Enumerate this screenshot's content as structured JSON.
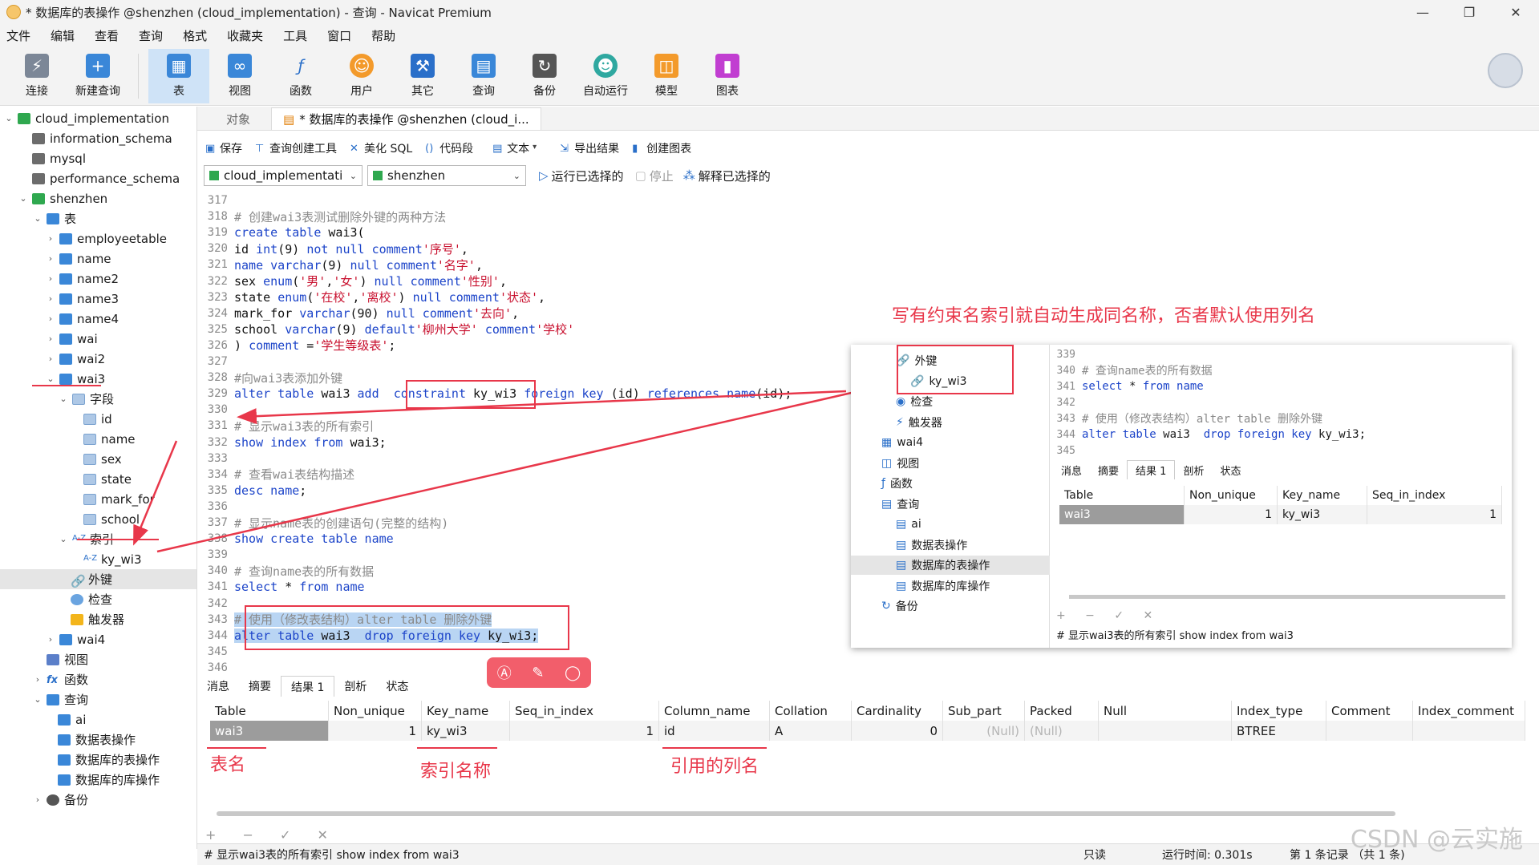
{
  "window": {
    "title": "* 数据库的表操作 @shenzhen (cloud_implementation) - 查询 - Navicat Premium",
    "controls": [
      "—",
      "❐",
      "✕"
    ]
  },
  "menu": [
    "文件",
    "编辑",
    "查看",
    "查询",
    "格式",
    "收藏夹",
    "工具",
    "窗口",
    "帮助"
  ],
  "toolbar": {
    "connect": "连接",
    "new_query": "新建查询",
    "table": "表",
    "view": "视图",
    "function": "函数",
    "user": "用户",
    "other": "其它",
    "query": "查询",
    "backup": "备份",
    "auto_run": "自动运行",
    "model": "模型",
    "chart": "图表"
  },
  "tree": {
    "root": "cloud_implementation",
    "dbs": [
      "information_schema",
      "mysql",
      "performance_schema",
      "shenzhen"
    ],
    "tables_label": "表",
    "tables": [
      "employeetable",
      "name",
      "name2",
      "name3",
      "name4",
      "wai",
      "wai2",
      "wai3"
    ],
    "fields_label": "字段",
    "fields": [
      "id",
      "name",
      "sex",
      "state",
      "mark_for",
      "school"
    ],
    "index_label": "索引",
    "index_item": "ky_wi3",
    "fk_label": "外键",
    "check_label": "检查",
    "trigger_label": "触发器",
    "wai4": "wai4",
    "views_label": "视图",
    "func_label": "函数",
    "query_label": "查询",
    "queries": [
      "ai",
      "数据表操作",
      "数据库的表操作",
      "数据库的库操作"
    ],
    "backup_label": "备份"
  },
  "tabs": {
    "objects": "对象",
    "query_tab": "* 数据库的表操作 @shenzhen (cloud_i..."
  },
  "query_toolbar": {
    "save": "保存",
    "builder": "查询创建工具",
    "beautify": "美化 SQL",
    "snippet": "代码段",
    "text": "文本",
    "export": "导出结果",
    "create_chart": "创建图表"
  },
  "selectors": {
    "connection": "cloud_implementati",
    "database": "shenzhen",
    "run_selected": "运行已选择的",
    "stop": "停止",
    "explain": "解释已选择的"
  },
  "code_lines": [
    {
      "n": "317",
      "html": ""
    },
    {
      "n": "318",
      "html": "<span class='cm'># 创建wai3表测试删除外键的两种方法</span>"
    },
    {
      "n": "319",
      "html": "<span class='kw'>create table</span> wai3("
    },
    {
      "n": "320",
      "html": "id <span class='kw'>int</span>(9) <span class='kw'>not null comment</span><span class='str'>'序号'</span>,"
    },
    {
      "n": "321",
      "html": "<span class='kw'>name varchar</span>(9) <span class='kw'>null comment</span><span class='str'>'名字'</span>,"
    },
    {
      "n": "322",
      "html": "sex <span class='kw'>enum</span>(<span class='str'>'男'</span>,<span class='str'>'女'</span>) <span class='kw'>null comment</span><span class='str'>'性别'</span>,"
    },
    {
      "n": "323",
      "html": "state <span class='kw'>enum</span>(<span class='str'>'在校'</span>,<span class='str'>'离校'</span>) <span class='kw'>null comment</span><span class='str'>'状态'</span>,"
    },
    {
      "n": "324",
      "html": "mark_for <span class='kw'>varchar</span>(90) <span class='kw'>null comment</span><span class='str'>'去向'</span>,"
    },
    {
      "n": "325",
      "html": "school <span class='kw'>varchar</span>(9) <span class='kw'>default</span><span class='str'>'柳州大学'</span> <span class='kw'>comment</span><span class='str'>'学校'</span>"
    },
    {
      "n": "326",
      "html": ") <span class='kw'>comment</span> =<span class='str'>'学生等级表'</span>;"
    },
    {
      "n": "327",
      "html": ""
    },
    {
      "n": "328",
      "html": "<span class='cm'>#向wai3表添加外键</span>"
    },
    {
      "n": "329",
      "html": "<span class='kw'>alter table</span> wai3 <span class='kw'>add</span>  <span class='kw'>constraint</span> ky_wi3 <span class='kw'>foreign key</span> (id) <span class='kw'>references name</span>(id);"
    },
    {
      "n": "330",
      "html": ""
    },
    {
      "n": "331",
      "html": "<span class='cm'># 显示wai3表的所有索引</span>"
    },
    {
      "n": "332",
      "html": "<span class='kw'>show index from</span> wai3;"
    },
    {
      "n": "333",
      "html": ""
    },
    {
      "n": "334",
      "html": "<span class='cm'># 查看wai表结构描述</span>"
    },
    {
      "n": "335",
      "html": "<span class='kw'>desc name</span>;"
    },
    {
      "n": "336",
      "html": ""
    },
    {
      "n": "337",
      "html": "<span class='cm'># 显示name表的创建语句(完整的结构)</span>"
    },
    {
      "n": "338",
      "html": "<span class='kw'>show create table name</span>"
    },
    {
      "n": "339",
      "html": ""
    },
    {
      "n": "340",
      "html": "<span class='cm'># 查询name表的所有数据</span>"
    },
    {
      "n": "341",
      "html": "<span class='kw'>select</span> * <span class='kw'>from name</span>"
    },
    {
      "n": "342",
      "html": ""
    },
    {
      "n": "343",
      "html": "<span class='hl'><span class='cm'># 使用（修改表结构）alter table 删除外键</span></span>"
    },
    {
      "n": "344",
      "html": "<span class='hl'><span class='kw'>alter table</span> wai3  <span class='kw'>drop foreign key</span> ky_wi3;</span>"
    },
    {
      "n": "345",
      "html": ""
    },
    {
      "n": "346",
      "html": ""
    }
  ],
  "result_tabs": [
    "消息",
    "摘要",
    "结果 1",
    "剖析",
    "状态"
  ],
  "result": {
    "headers": [
      "Table",
      "Non_unique",
      "Key_name",
      "Seq_in_index",
      "Column_name",
      "Collation",
      "Cardinality",
      "Sub_part",
      "Packed",
      "Null",
      "Index_type",
      "Comment",
      "Index_comment"
    ],
    "row": [
      "wai3",
      "1",
      "ky_wi3",
      "1",
      "id",
      "A",
      "0",
      "(Null)",
      "(Null)",
      "",
      "BTREE",
      "",
      ""
    ]
  },
  "bottom_icons": "+ − ✓ ✕",
  "status": {
    "sql": "# 显示wai3表的所有索引 show index from wai3",
    "readonly": "只读",
    "elapsed": "运行时间: 0.301s",
    "records": "第 1 条记录 （共 1 条)"
  },
  "annotations": {
    "top_note": "写有约束名索引就自动生成同名称，否者默认使用列名",
    "table_name": "表名",
    "index_name": "索引名称",
    "column_name": "引用的列名"
  },
  "inset": {
    "tree": [
      {
        "label": "外键",
        "indent": 2
      },
      {
        "label": "ky_wi3",
        "indent": 3
      },
      {
        "label": "检查",
        "indent": 2
      },
      {
        "label": "触发器",
        "indent": 2
      },
      {
        "label": "wai4",
        "indent": 1
      },
      {
        "label": "视图",
        "indent": 1
      },
      {
        "label": "函数",
        "indent": 1
      },
      {
        "label": "查询",
        "indent": 1
      },
      {
        "label": "ai",
        "indent": 2
      },
      {
        "label": "数据表操作",
        "indent": 2
      },
      {
        "label": "数据库的表操作",
        "indent": 2
      },
      {
        "label": "数据库的库操作",
        "indent": 2
      },
      {
        "label": "备份",
        "indent": 1
      }
    ],
    "code": [
      {
        "n": "339",
        "html": ""
      },
      {
        "n": "340",
        "html": "<span class='cm'># 查询name表的所有数据</span>"
      },
      {
        "n": "341",
        "html": "<span class='kw'>select</span> * <span class='kw'>from name</span>"
      },
      {
        "n": "342",
        "html": ""
      },
      {
        "n": "343",
        "html": "<span class='cm'># 使用（修改表结构）alter table 删除外键</span>"
      },
      {
        "n": "344",
        "html": "<span class='kw'>alter table</span> wai3  <span class='kw'>drop foreign key</span> ky_wi3;"
      },
      {
        "n": "345",
        "html": ""
      }
    ],
    "tabs": [
      "消息",
      "摘要",
      "结果 1",
      "剖析",
      "状态"
    ],
    "headers": [
      "Table",
      "Non_unique",
      "Key_name",
      "Seq_in_index"
    ],
    "row": [
      "wai3",
      "1",
      "ky_wi3",
      "1"
    ],
    "status": "# 显示wai3表的所有索引 show index from wai3"
  },
  "watermark": "CSDN @云实施"
}
